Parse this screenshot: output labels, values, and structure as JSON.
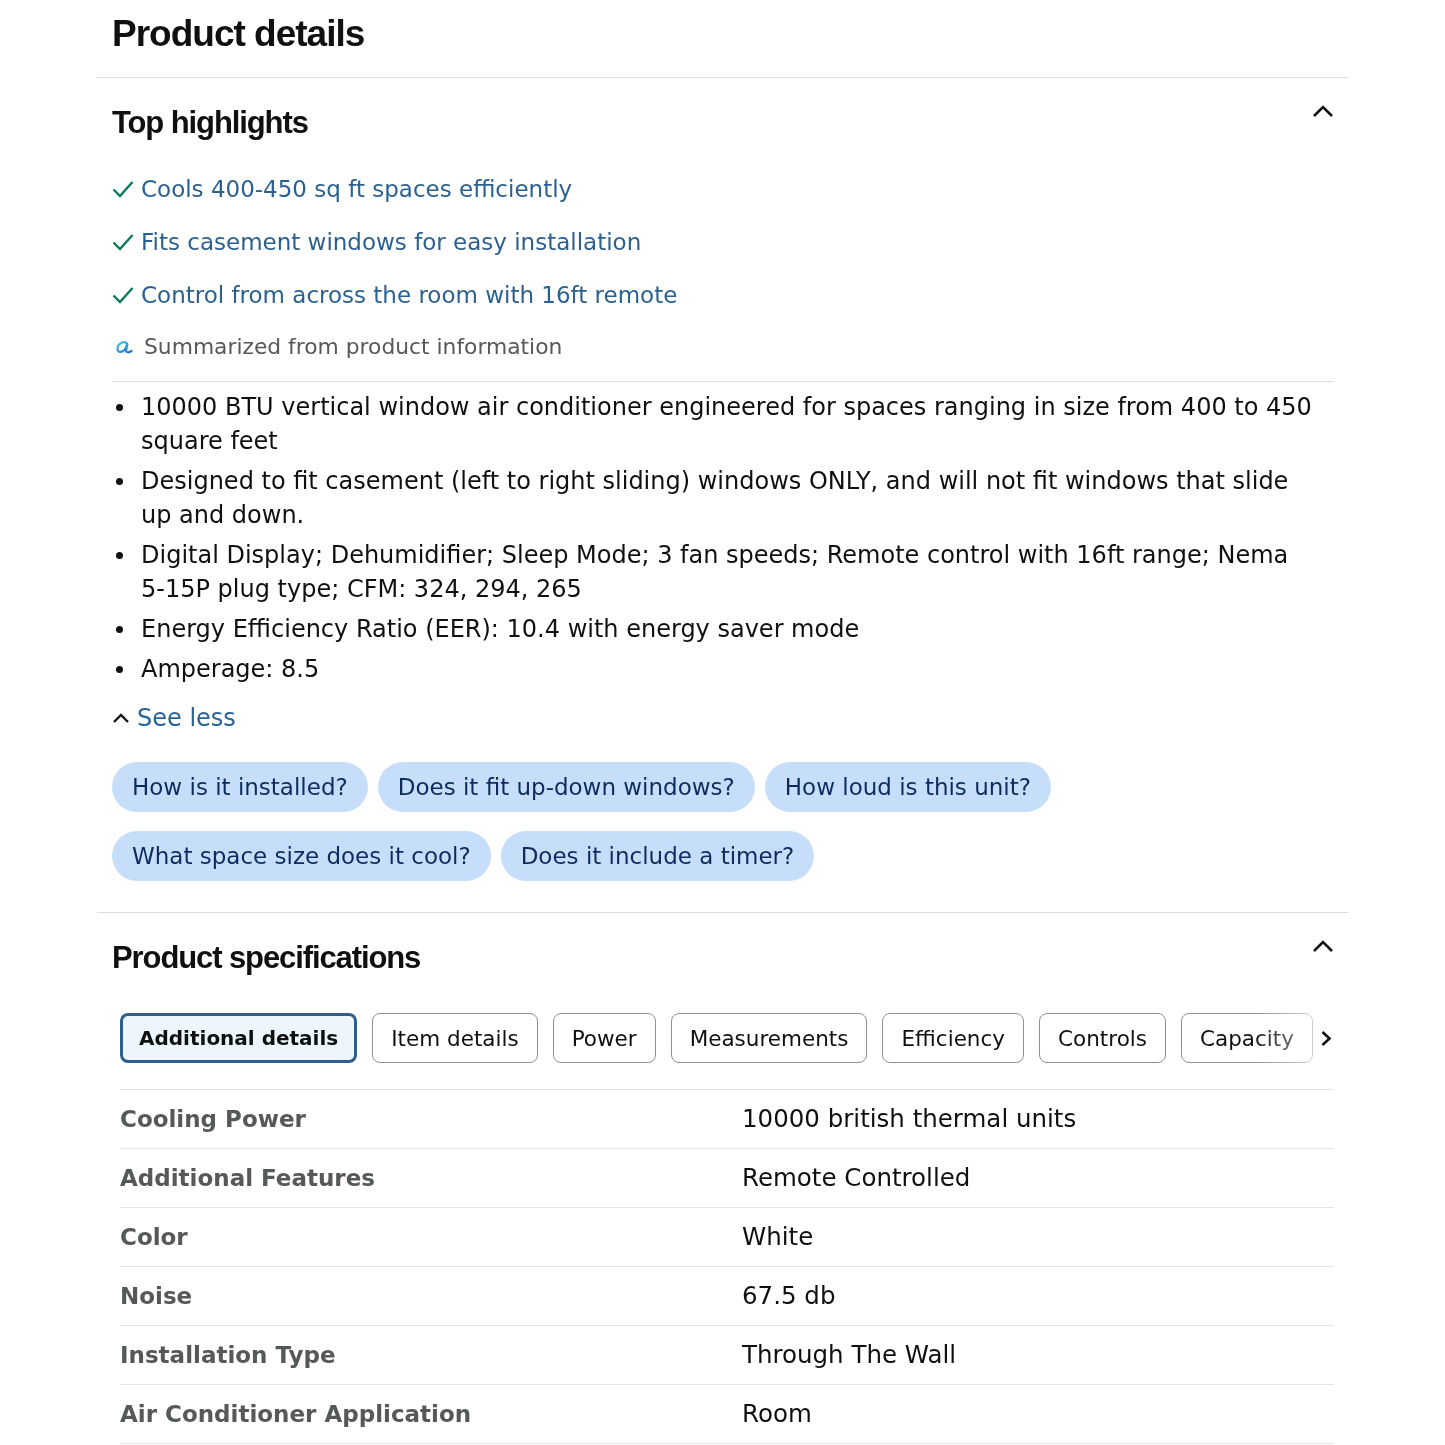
{
  "page_title": "Product details",
  "top_highlights": {
    "title": "Top highlights",
    "expanded": true,
    "highlights": [
      "Cools 400-450 sq ft spaces efficiently",
      "Fits casement windows for easy installation",
      "Control from across the room with 16ft remote"
    ],
    "summary_note": "Summarized from product information",
    "bullets": [
      "10000 BTU vertical window air conditioner engineered for spaces ranging in size from 400 to 450 square feet",
      "Designed to fit casement (left to right sliding) windows ONLY, and will not fit windows that slide up and down.",
      "Digital Display; Dehumidifier; Sleep Mode; 3 fan speeds; Remote control with 16ft range; Nema 5-15P plug type; CFM: 324, 294, 265",
      "Energy Efficiency Ratio (EER): 10.4 with energy saver mode",
      "Amperage: 8.5"
    ],
    "toggle": {
      "label": "See less",
      "expanded": true
    },
    "questions": [
      "How is it installed?",
      "Does it fit up-down windows?",
      "How loud is this unit?",
      "What space size does it cool?",
      "Does it include a timer?"
    ]
  },
  "product_specifications": {
    "title": "Product specifications",
    "expanded": true,
    "tabs": [
      {
        "label": "Additional details",
        "selected": true
      },
      {
        "label": "Item details",
        "selected": false
      },
      {
        "label": "Power",
        "selected": false
      },
      {
        "label": "Measurements",
        "selected": false
      },
      {
        "label": "Efficiency",
        "selected": false
      },
      {
        "label": "Controls",
        "selected": false
      },
      {
        "label": "Capacity",
        "selected": false
      }
    ],
    "rows": [
      {
        "label": "Cooling Power",
        "value": "10000 british thermal units"
      },
      {
        "label": "Additional Features",
        "value": "Remote Controlled"
      },
      {
        "label": "Color",
        "value": "White"
      },
      {
        "label": "Noise",
        "value": "67.5 db"
      },
      {
        "label": "Installation Type",
        "value": "Through The Wall"
      },
      {
        "label": "Air Conditioner Application",
        "value": "Room"
      }
    ]
  }
}
